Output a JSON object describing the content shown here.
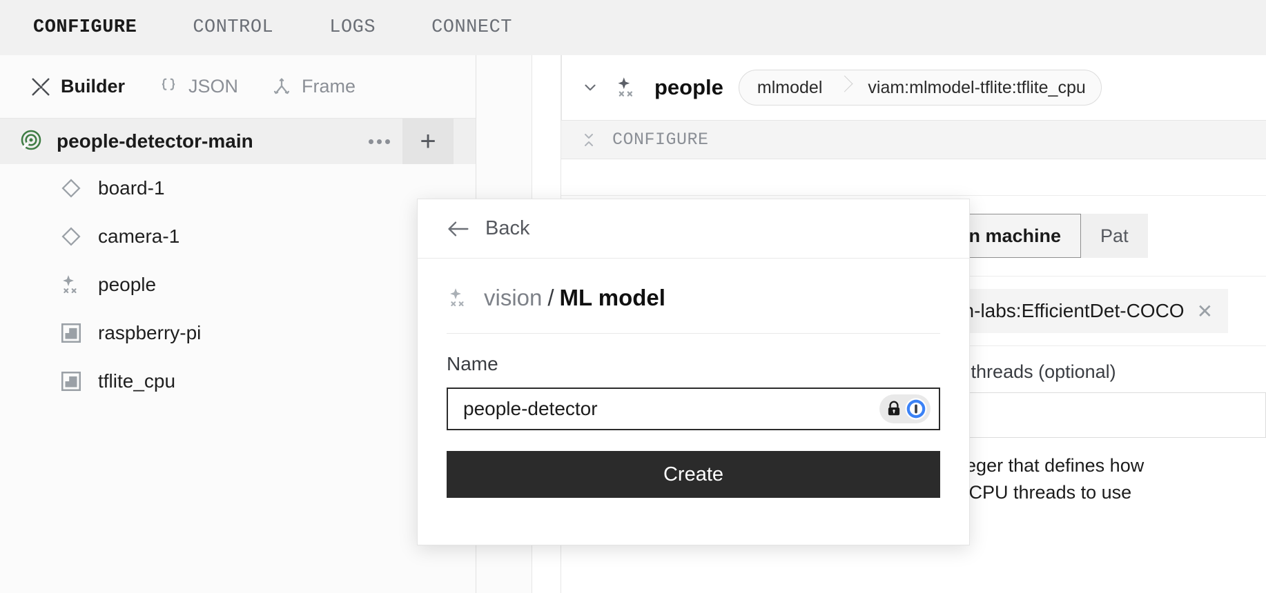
{
  "topnav": {
    "items": [
      {
        "label": "CONFIGURE",
        "active": true
      },
      {
        "label": "CONTROL",
        "active": false
      },
      {
        "label": "LOGS",
        "active": false
      },
      {
        "label": "CONNECT",
        "active": false
      }
    ]
  },
  "builder_bar": {
    "items": [
      {
        "label": "Builder",
        "icon": "tools-icon",
        "active": true
      },
      {
        "label": "JSON",
        "icon": "braces-icon",
        "active": false
      },
      {
        "label": "Frame",
        "icon": "frame-tree-icon",
        "active": false
      }
    ]
  },
  "sidebar": {
    "machine": {
      "label": "people-detector-main",
      "icon": "machine-status-icon"
    },
    "menu_icon": "ellipsis-icon",
    "add_icon": "plus-icon",
    "items": [
      {
        "label": "board-1",
        "icon": "diamond-icon"
      },
      {
        "label": "camera-1",
        "icon": "diamond-icon"
      },
      {
        "label": "people",
        "icon": "vision-sparkle-icon"
      },
      {
        "label": "raspberry-pi",
        "icon": "board-square-icon"
      },
      {
        "label": "tflite_cpu",
        "icon": "board-square-icon"
      }
    ]
  },
  "component_card": {
    "expand_icon": "chevron-down-icon",
    "type_icon": "vision-sparkle-icon",
    "name": "people",
    "api_chip": "mlmodel",
    "model_chip": "viam:mlmodel-tflite:tflite_cpu",
    "configure_label": "CONFIGURE",
    "collapse_icon": "collapse-vertical-icon",
    "tabs": [
      {
        "label": "Deploy model on machine",
        "visible_label": "ploy model on machine",
        "active": true
      },
      {
        "label": "Path to existing model on robot",
        "visible_label": "Pat",
        "active": false
      }
    ],
    "selected_model": "viam-labs:EfficientDet-COCO",
    "selected_model_visible": "viam-labs:EfficientDet-COCO",
    "remove_icon": "close-x-icon",
    "threads_label": "Number of threads (optional)",
    "threads_label_visible": "ber of threads (optional)",
    "threads_value": "",
    "threads_help_line1": "An integer that defines how",
    "threads_help_line2": "many CPU threads to use"
  },
  "modal": {
    "back_label": "Back",
    "back_icon": "arrow-left-icon",
    "title_icon": "vision-sparkle-icon",
    "title_prefix": "vision",
    "title_separator": "/",
    "title_main": "ML model",
    "name_label": "Name",
    "name_value": "people-detector",
    "name_placeholder": "Name",
    "autofill_lock_icon": "lock-icon",
    "autofill_key_icon": "password-key-icon",
    "create_label": "Create"
  },
  "colors": {
    "accent_blue": "#3b82f6",
    "machine_green": "#3f7d44",
    "button_dark": "#2b2b2b",
    "topbar_bg": "#f1f1f1",
    "panel_bg": "#fbfbfb"
  }
}
